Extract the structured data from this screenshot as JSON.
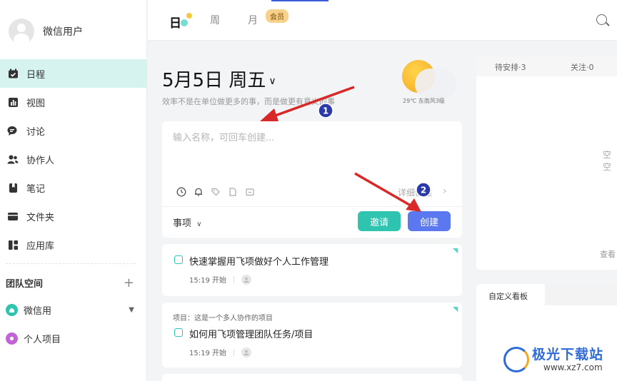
{
  "user": {
    "name": "微信用户"
  },
  "sidebar": {
    "items": [
      {
        "label": "日程",
        "icon": "calendar-icon",
        "active": true
      },
      {
        "label": "视图",
        "icon": "chart-icon"
      },
      {
        "label": "讨论",
        "icon": "chat-icon"
      },
      {
        "label": "协作人",
        "icon": "people-icon"
      },
      {
        "label": "笔记",
        "icon": "note-icon"
      },
      {
        "label": "文件夹",
        "icon": "folder-icon"
      },
      {
        "label": "应用库",
        "icon": "apps-icon"
      }
    ],
    "team_title": "团队空间",
    "team_add": "+",
    "teams": [
      {
        "label": "微信用",
        "color": "#2ec4b0"
      },
      {
        "label": "个人项目",
        "color": "#c264d6"
      }
    ]
  },
  "topbar": {
    "tabs": [
      {
        "label": "日",
        "active": true
      },
      {
        "label": "周"
      },
      {
        "label": "月"
      }
    ],
    "vip_badge": "会员"
  },
  "main": {
    "date": "5月5日 周五",
    "quote": "效率不是在单位做更多的事，而是做更有意义的事",
    "weather": "29℃ 东南风3级",
    "input_placeholder": "输入名称，可回车创建...",
    "detail_label": "详细创建",
    "type_select": "事项",
    "invite_button": "邀请",
    "create_button": "创建"
  },
  "tasks": [
    {
      "project": "",
      "title": "快速掌握用飞项做好个人工作管理",
      "time": "15:19 开始"
    },
    {
      "project": "项目：这是一个多人协作的项目",
      "title": "如何用飞项管理团队任务/项目",
      "time": "15:19 开始"
    }
  ],
  "right_panel": {
    "tabs": [
      "待安排·3",
      "关注·0"
    ],
    "empty_text": "空空",
    "view_link": "查看",
    "board_tab": "自定义看板"
  },
  "annotations": [
    "1",
    "2"
  ],
  "watermark": {
    "text": "极光下载站",
    "url": "www.xz7.com"
  },
  "colors": {
    "accent": "#2ec4b0",
    "primary": "#5b78f0",
    "active_bg": "#d6f3ef",
    "arrow": "#d82828"
  }
}
